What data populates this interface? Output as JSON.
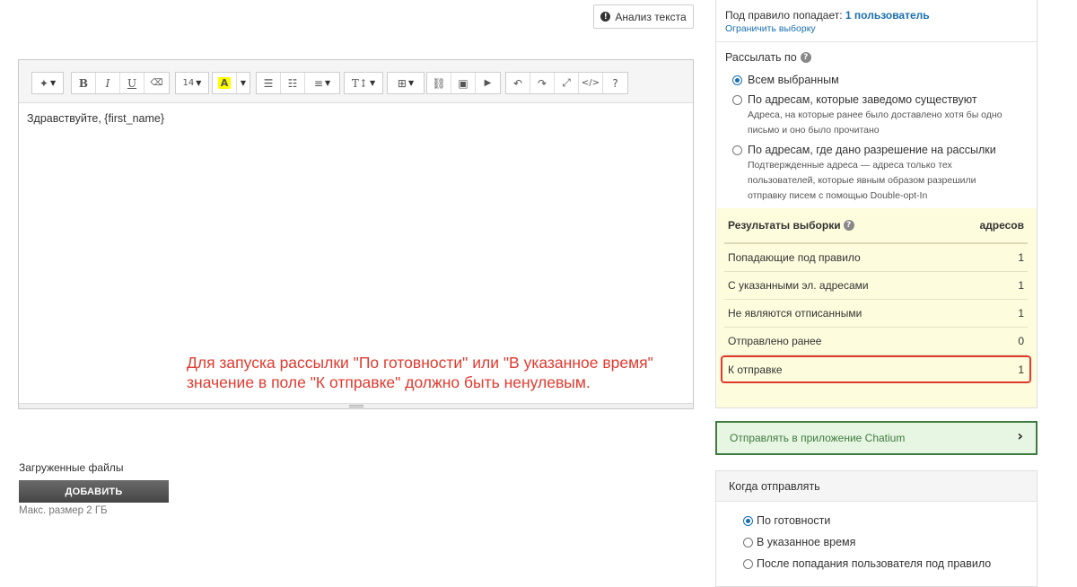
{
  "analyze_button": {
    "label": "Анализ текста",
    "icon": "info-icon"
  },
  "editor": {
    "toolbar": [
      {
        "name": "magic-wand-icon",
        "glyph": "✦"
      },
      {
        "name": "bold-icon",
        "glyph": "B"
      },
      {
        "name": "italic-icon",
        "glyph": "I"
      },
      {
        "name": "underline-icon",
        "glyph": "U"
      },
      {
        "name": "eraser-icon",
        "glyph": "⌫"
      },
      {
        "name": "font-size-select",
        "glyph": "14"
      },
      {
        "name": "highlight-color-icon",
        "glyph": "A"
      },
      {
        "name": "bullet-list-icon",
        "glyph": "☰"
      },
      {
        "name": "numbered-list-icon",
        "glyph": "☷"
      },
      {
        "name": "align-icon",
        "glyph": "≡"
      },
      {
        "name": "text-style-icon",
        "glyph": "T↕"
      },
      {
        "name": "table-icon",
        "glyph": "⊞"
      },
      {
        "name": "link-icon",
        "glyph": "⛓"
      },
      {
        "name": "image-icon",
        "glyph": "▣"
      },
      {
        "name": "video-icon",
        "glyph": "▶"
      },
      {
        "name": "undo-icon",
        "glyph": "↶"
      },
      {
        "name": "redo-icon",
        "glyph": "↷"
      },
      {
        "name": "fullscreen-icon",
        "glyph": "⤢"
      },
      {
        "name": "code-view-icon",
        "glyph": "</>"
      },
      {
        "name": "help-icon",
        "glyph": "?"
      }
    ],
    "body_text": "Здравствуйте, {first_name}"
  },
  "annotation": {
    "line1": "Для запуска рассылки \"По готовности\" или \"В указанное время\"",
    "line2": "значение в поле \"К отправке\" должно быть ненулевым.",
    "color": "#e03a2e"
  },
  "files": {
    "label": "Загруженные файлы",
    "add_button": "ДОБАВИТЬ",
    "max_size": "Макс. размер 2 ГБ"
  },
  "rule": {
    "prefix": "Под правило попадает:",
    "value": "1 пользователь",
    "limit_link": "Ограничить выборку"
  },
  "send_by": {
    "label": "Рассылать по",
    "options": [
      {
        "label": "Всем выбранным",
        "desc": "",
        "selected": true
      },
      {
        "label": "По адресам, которые заведомо существуют",
        "desc": "Адреса, на которые ранее было доставлено хотя бы одно письмо и оно было прочитано",
        "selected": false
      },
      {
        "label": "По адресам, где дано разрешение на рассылки",
        "desc": "Подтвержденные адреса — адреса только тех пользователей, которые явным образом разрешили отправку писем с помощью Double-opt-In",
        "selected": false
      }
    ]
  },
  "results": {
    "title": "Результаты выборки",
    "column": "адресов",
    "rows": [
      {
        "label": "Попадающие под правило",
        "value": "1"
      },
      {
        "label": "С указанными эл. адресами",
        "value": "1"
      },
      {
        "label": "Не являются отписанными",
        "value": "1"
      },
      {
        "label": "Отправлено ранее",
        "value": "0"
      },
      {
        "label": "К отправке",
        "value": "1"
      }
    ],
    "highlight_color": "#e03a2e"
  },
  "chatium": {
    "label": "Отправлять в приложение Chatium",
    "icon": "chevron-right-icon"
  },
  "when": {
    "title": "Когда отправлять",
    "options": [
      {
        "label": "По готовности",
        "selected": true
      },
      {
        "label": "В указанное время",
        "selected": false
      },
      {
        "label": "После попадания пользователя под правило",
        "selected": false
      }
    ]
  }
}
